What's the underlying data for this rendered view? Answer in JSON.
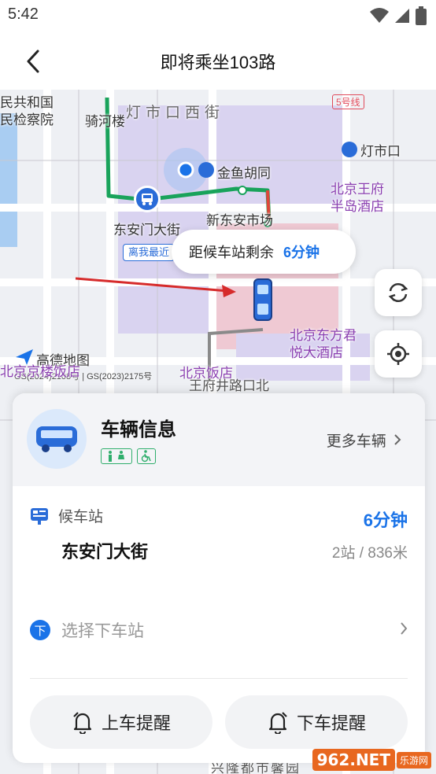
{
  "status_bar": {
    "time": "5:42"
  },
  "header": {
    "title": "即将乘坐103路"
  },
  "map": {
    "labels": {
      "procuratorate": "民共和国\n民检察院",
      "qiheloue": "骑河楼",
      "dengshikou_west": "灯市口西街",
      "line5": "5号线",
      "dengshikou": "灯市口",
      "jinyu": "金鱼胡同",
      "peninsula": "北京王府\n半岛酒店",
      "xindongan": "新东安市场",
      "dongan_stop": "东安门大街",
      "regent": "北京东方君\n悦大酒店",
      "gaode": "高德地图",
      "copyright": "GS(2024)2108号 | GS(2023)2175号",
      "hotel_left": "北京京楼饭店",
      "bjhotel": "北京饭店",
      "wangfujing": "王府井路口北",
      "bottom_road": "兴隆都市馨园"
    },
    "nearest_tag": "离我最近",
    "bubble": {
      "text": "距候车站剩余",
      "minutes": "6分钟"
    }
  },
  "card": {
    "title": "车辆信息",
    "more_vehicles": "更多车辆",
    "waiting_stop_label": "候车站",
    "waiting_stop_name": "东安门大街",
    "eta": "6分钟",
    "distance": "2站 / 836米",
    "alight_badge": "下",
    "alight_placeholder": "选择下车站",
    "board_reminder": "上车提醒",
    "alight_reminder": "下车提醒"
  },
  "colors": {
    "accent": "#1a73e8",
    "route": "#19a35b",
    "map_block": "#d9d3f0"
  },
  "watermark": {
    "brand": "962.NET",
    "sub": "乐游网"
  }
}
